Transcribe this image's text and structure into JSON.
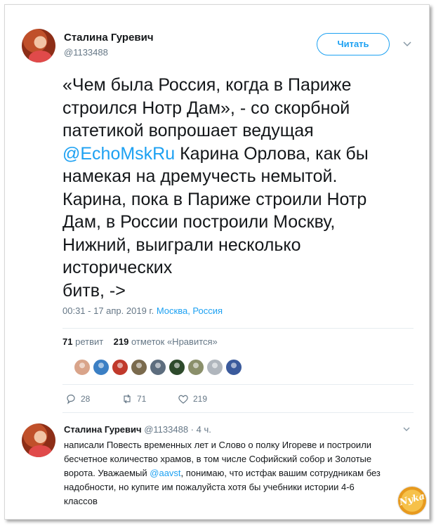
{
  "tweet": {
    "author_name": "Сталина Гуревич",
    "author_handle": "@1133488",
    "follow_label": "Читать",
    "text_lines": [
      "«Чем была Россия, когда в Париже",
      "строился Нотр Дам», - со скорбной",
      "патетикой вопрошает ведущая",
      {
        "mention": "@EchoMskRu",
        "rest": " Карина Орлова, как бы"
      },
      "намекая на дремучесть немытой.",
      "Карина, пока в Париже строили Нотр",
      "Дам, в России построили Москву,",
      "Нижний, выиграли несколько",
      "исторических",
      "битв, ->"
    ],
    "timestamp": "00:31 - 17 апр. 2019 г.",
    "location": "Москва, Россия",
    "retweets_count": "71",
    "retweets_label": "ретвит",
    "likes_count": "219",
    "likes_label": "отметок «Нравится»",
    "likers_colors": [
      "#d9a48a",
      "#3b7fc4",
      "#c0392b",
      "#7a6a4d",
      "#5d6d7e",
      "#2d4a2b",
      "#8a8f6a",
      "#b0b6bd",
      "#3a5a9c"
    ],
    "actions": {
      "reply_count": "28",
      "retweet_count": "71",
      "like_count": "219"
    }
  },
  "reply": {
    "author_name": "Сталина Гуревич",
    "author_handle": "@1133488",
    "age": "4 ч.",
    "text_lines": [
      "написали Повесть временных лет и Слово о полку Игореве и построили",
      "бесчетное количество храмов, в том числе Софийский собор и Золотые",
      {
        "pre": "ворота. Уважаемый ",
        "mention": "@aavst",
        "post": ", понимаю, что истфак вашим сотрудникам без"
      },
      "надобности, но купите им пожалуйста хотя бы учебники истории 4-6",
      "классов"
    ]
  },
  "watermark": {
    "text": "Nyka"
  }
}
